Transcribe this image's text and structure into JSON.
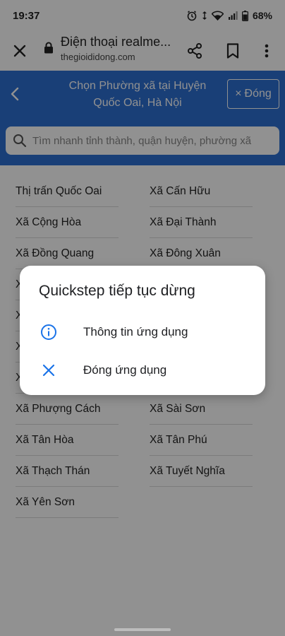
{
  "status_bar": {
    "time": "19:37",
    "battery_percent": "68%",
    "icons": [
      "alarm-icon",
      "data-arrows-icon",
      "wifi-icon",
      "signal-icon",
      "battery-icon"
    ]
  },
  "browser": {
    "page_title": "Điện thoại realme...",
    "url": "thegioididong.com",
    "icons": [
      "close-icon",
      "lock-icon",
      "share-icon",
      "bookmark-icon",
      "more-vert-icon"
    ]
  },
  "location_picker": {
    "title_line1": "Chọn Phường xã tại Huyện",
    "title_line2": "Quốc Oai, Hà Nội",
    "close_label": "Đóng",
    "search_placeholder": "Tìm nhanh tỉnh thành, quận huyện, phường xã",
    "wards": [
      "Thị trấn Quốc Oai",
      "Xã Cấn Hữu",
      "Xã Cộng Hòa",
      "Xã Đại Thành",
      "Xã Đồng Quang",
      "Xã Đông Xuân",
      "X",
      "",
      "X",
      "",
      "X",
      "",
      "X",
      "",
      "Xã Phượng Cách",
      "Xã Sài Sơn",
      "Xã Tân Hòa",
      "Xã Tân Phú",
      "Xã Thạch Thán",
      "Xã Tuyết Nghĩa",
      "Xã Yên Sơn"
    ]
  },
  "dialog": {
    "title": "Quickstep tiếp tục dừng",
    "options": [
      {
        "label": "Thông tin ứng dụng",
        "icon": "info-icon"
      },
      {
        "label": "Đóng ứng dụng",
        "icon": "close-icon"
      }
    ]
  },
  "colors": {
    "header_blue": "#2d6fd2",
    "dialog_accent": "#1a73e8"
  }
}
